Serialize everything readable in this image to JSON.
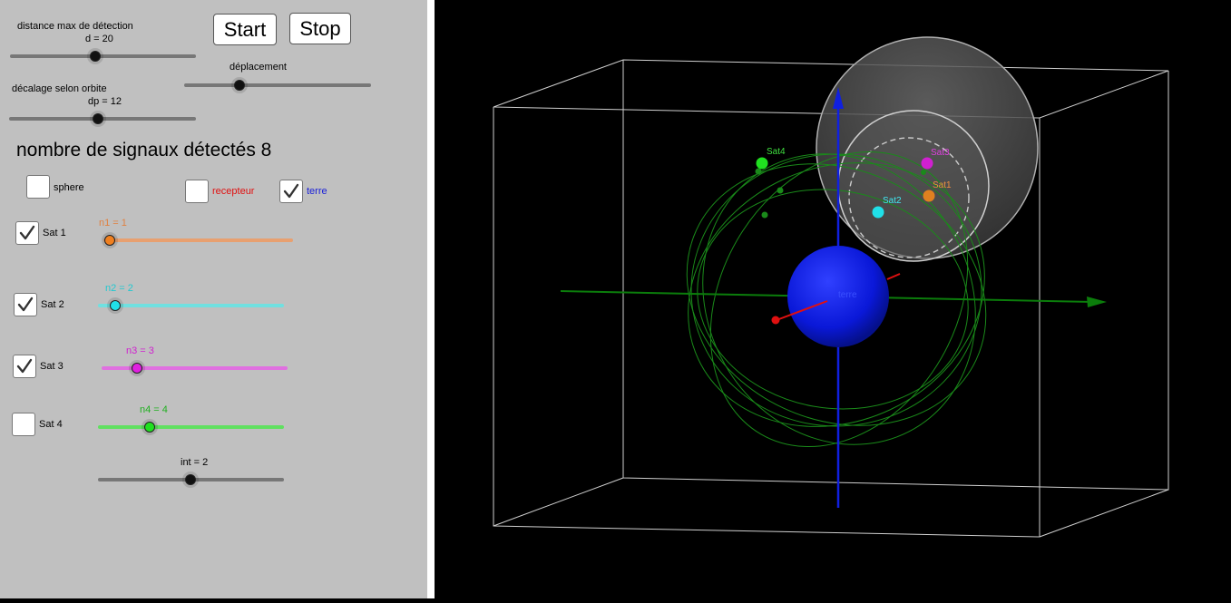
{
  "controls": {
    "distance": {
      "label": "distance max de détection",
      "value_text": "d = 20"
    },
    "deplacement": {
      "label": "déplacement"
    },
    "decalage": {
      "label": "décalage selon orbite",
      "value_text": "dp = 12"
    },
    "start_label": "Start",
    "stop_label": "Stop",
    "signal_count_text": "nombre de signaux détectés 8",
    "sphere": {
      "label": "sphere",
      "checked": false
    },
    "recepteur": {
      "label": "recepteur",
      "checked": false
    },
    "terre": {
      "label": "terre",
      "checked": true
    },
    "interval": {
      "value_text": "int = 2"
    }
  },
  "satellites": [
    {
      "label": "Sat 1",
      "checked": true,
      "value_text": "n1 = 1",
      "color": "#e8a070",
      "knob_color": "#f08020",
      "tag": "Sat1"
    },
    {
      "label": "Sat 2",
      "checked": true,
      "value_text": "n2 = 2",
      "color": "#70e0e0",
      "knob_color": "#20e0e8",
      "tag": "Sat2"
    },
    {
      "label": "Sat 3",
      "checked": true,
      "value_text": "n3 = 3",
      "color": "#e070e0",
      "knob_color": "#e020e0",
      "tag": "Sat3"
    },
    {
      "label": "Sat 4",
      "checked": false,
      "value_text": "n4 = 4",
      "color": "#60e060",
      "knob_color": "#20e020",
      "tag": "Sat4"
    }
  ],
  "scene": {
    "earth_label": "terre",
    "colors": {
      "earth": "#0a18d8",
      "orbit": "#1a8a1a",
      "axis_x": "#0b7d0b",
      "axis_z": "#1020e0",
      "receiver": "#e01010",
      "box": "#cfcfcf"
    }
  }
}
